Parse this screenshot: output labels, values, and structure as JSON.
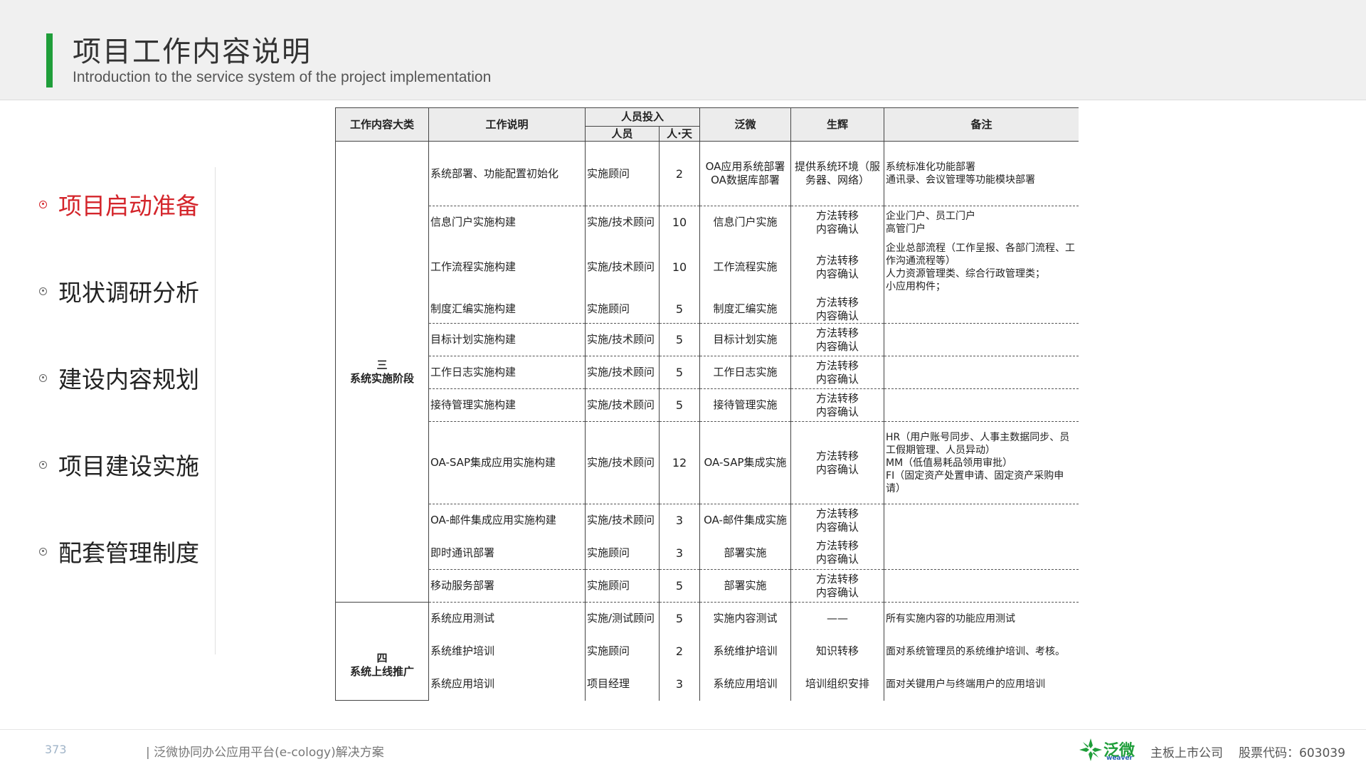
{
  "header": {
    "title": "项目工作内容说明",
    "subtitle": "Introduction to the service system of the project implementation"
  },
  "nav": {
    "items": [
      {
        "label": "项目启动准备",
        "active": true
      },
      {
        "label": "现状调研分析",
        "active": false
      },
      {
        "label": "建设内容规划",
        "active": false
      },
      {
        "label": "项目建设实施",
        "active": false
      },
      {
        "label": "配套管理制度",
        "active": false
      }
    ]
  },
  "table": {
    "headers": {
      "category": "工作内容大类",
      "description": "工作说明",
      "staffing": "人员投入",
      "personnel": "人员",
      "person_days": "人·天",
      "weaver": "泛微",
      "shenghui": "生辉",
      "remarks": "备注"
    },
    "categories": {
      "stage3": "三\n系统实施阶段",
      "stage4": "四\n系统上线推广"
    },
    "rows": [
      {
        "desc": "系统部署、功能配置初始化",
        "person": "实施顾问",
        "days": "2",
        "weaver": "OA应用系统部署 OA数据库部署",
        "shenghui": "提供系统环境（服务器、网络）",
        "remark": "系统标准化功能部署\n通讯录、会议管理等功能模块部署"
      },
      {
        "desc": "信息门户实施构建",
        "person": "实施/技术顾问",
        "days": "10",
        "weaver": "信息门户实施",
        "shenghui": "方法转移\n内容确认",
        "remark": "企业门户、员工门户\n高管门户"
      },
      {
        "desc": "工作流程实施构建",
        "person": "实施/技术顾问",
        "days": "10",
        "weaver": "工作流程实施",
        "shenghui": "方法转移\n内容确认",
        "remark": "企业总部流程（工作呈报、各部门流程、工作沟通流程等）\n人力资源管理类、综合行政管理类；\n小应用构件；"
      },
      {
        "desc": "制度汇编实施构建",
        "person": "实施顾问",
        "days": "5",
        "weaver": "制度汇编实施",
        "shenghui": "方法转移\n内容确认",
        "remark": ""
      },
      {
        "desc": "目标计划实施构建",
        "person": "实施/技术顾问",
        "days": "5",
        "weaver": "目标计划实施",
        "shenghui": "方法转移\n内容确认",
        "remark": ""
      },
      {
        "desc": "工作日志实施构建",
        "person": "实施/技术顾问",
        "days": "5",
        "weaver": "工作日志实施",
        "shenghui": "方法转移\n内容确认",
        "remark": ""
      },
      {
        "desc": "接待管理实施构建",
        "person": "实施/技术顾问",
        "days": "5",
        "weaver": "接待管理实施",
        "shenghui": "方法转移\n内容确认",
        "remark": ""
      },
      {
        "desc": "OA-SAP集成应用实施构建",
        "person": "实施/技术顾问",
        "days": "12",
        "weaver": "OA-SAP集成实施",
        "shenghui": "方法转移\n内容确认",
        "remark": "HR（用户账号同步、人事主数据同步、员工假期管理、人员异动）\nMM（低值易耗品领用审批）\nFI（固定资产处置申请、固定资产采购申请）"
      },
      {
        "desc": "OA-邮件集成应用实施构建",
        "person": "实施/技术顾问",
        "days": "3",
        "weaver": "OA-邮件集成实施",
        "shenghui": "方法转移\n内容确认",
        "remark": ""
      },
      {
        "desc": "即时通讯部署",
        "person": "实施顾问",
        "days": "3",
        "weaver": "部署实施",
        "shenghui": "方法转移\n内容确认",
        "remark": ""
      },
      {
        "desc": "移动服务部署",
        "person": "实施顾问",
        "days": "5",
        "weaver": "部署实施",
        "shenghui": "方法转移\n内容确认",
        "remark": ""
      },
      {
        "desc": "系统应用测试",
        "person": "实施/测试顾问",
        "days": "5",
        "weaver": "实施内容测试",
        "shenghui": "——",
        "remark": "所有实施内容的功能应用测试"
      },
      {
        "desc": "系统维护培训",
        "person": "实施顾问",
        "days": "2",
        "weaver": "系统维护培训",
        "shenghui": "知识转移",
        "remark": "面对系统管理员的系统维护培训、考核。"
      },
      {
        "desc": "系统应用培训",
        "person": "项目经理",
        "days": "3",
        "weaver": "系统应用培训",
        "shenghui": "培训组织安排",
        "remark": "面对关键用户与终端用户的应用培训"
      }
    ]
  },
  "footer": {
    "page": "373",
    "doc_title": "| 泛微协同办公应用平台(e-cology)解决方案",
    "brand": "泛微",
    "brand_en": "weaver",
    "market": "主板上市公司",
    "stock_code": "股票代码：603039"
  },
  "colors": {
    "accent_green": "#1f9e3a",
    "active_red": "#d4252b"
  }
}
